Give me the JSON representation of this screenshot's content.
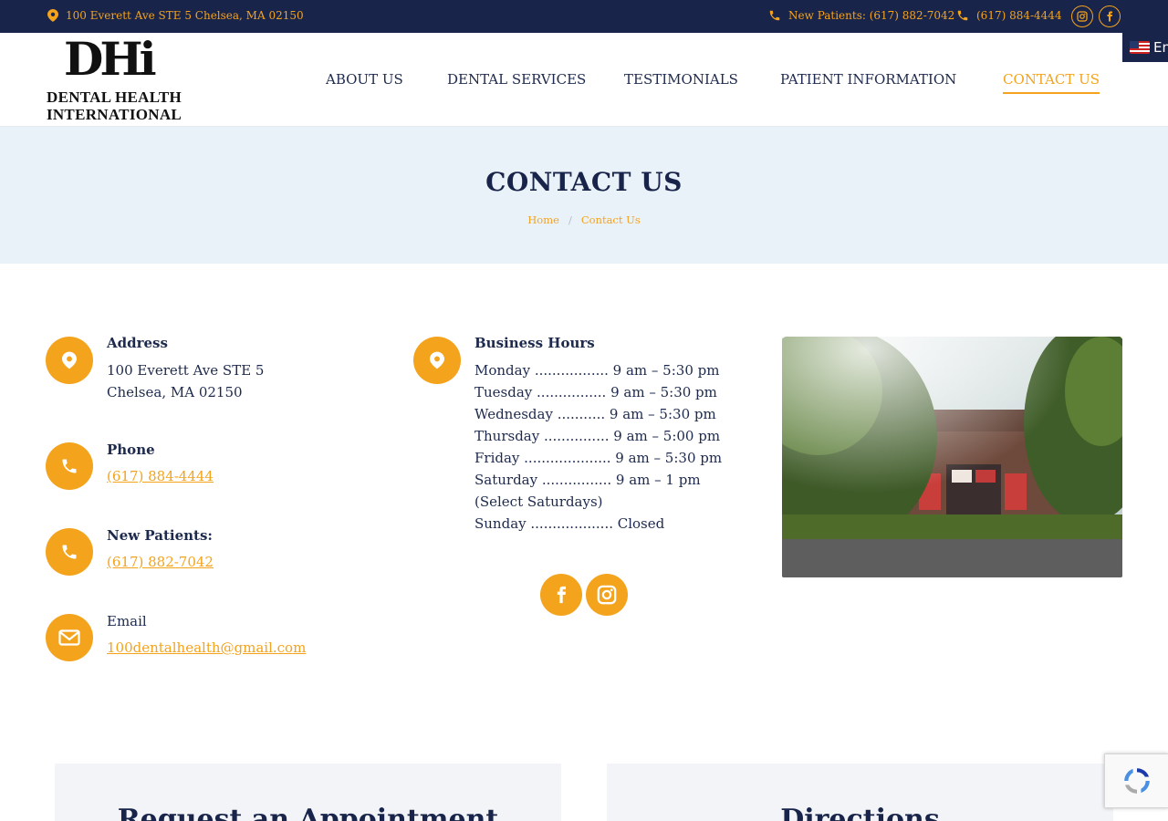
{
  "topbar": {
    "address": "100 Everett Ave STE 5 Chelsea, MA 02150",
    "new_patients": "New Patients: (617) 882-7042",
    "phone": "(617) 884-4444"
  },
  "logo": {
    "mark": "DHi",
    "line1": "DENTAL HEALTH",
    "line2": "INTERNATIONAL"
  },
  "nav": [
    "ABOUT US",
    "DENTAL SERVICES",
    "TESTIMONIALS",
    "PATIENT INFORMATION",
    "CONTACT US"
  ],
  "language": {
    "label": "En"
  },
  "page_title": "CONTACT US",
  "breadcrumb": {
    "home": "Home",
    "current": "Contact Us"
  },
  "address": {
    "label": "Address",
    "line1": "100 Everett Ave STE 5",
    "line2": "Chelsea, MA 02150"
  },
  "phone": {
    "label": "Phone",
    "value": "(617) 884-4444"
  },
  "new_patients": {
    "label": "New Patients:",
    "value": "(617) 882-7042"
  },
  "email": {
    "label": "Email",
    "value": "100dentalhealth@gmail.com"
  },
  "hours": {
    "label": "Business Hours",
    "rows": [
      "Monday ................. 9 am – 5:30 pm",
      "Tuesday ................ 9 am – 5:30 pm",
      "Wednesday ........... 9 am – 5:30 pm",
      "Thursday ............... 9 am – 5:00 pm",
      "Friday .................... 9 am – 5:30 pm",
      "Saturday ................ 9 am – 1 pm (Select Saturdays)",
      "Sunday ................... Closed"
    ]
  },
  "cards": {
    "appointment": "Request an Appointment",
    "directions": "Directions"
  },
  "colors": {
    "navy": "#18244a",
    "accent": "#f4a31d",
    "title_bg": "#eaf2f9"
  },
  "icons": [
    "map-pin-icon",
    "phone-icon",
    "instagram-icon",
    "facebook-icon",
    "envelope-icon",
    "recaptcha-icon"
  ]
}
